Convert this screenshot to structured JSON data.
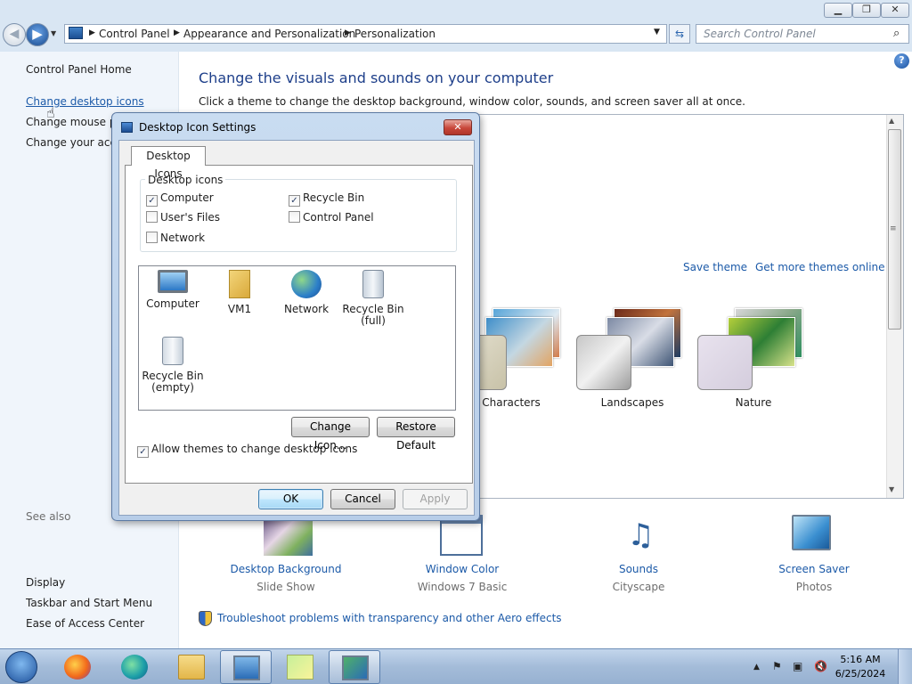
{
  "window": {
    "minimize": "▁",
    "maximize": "❐",
    "close": "✕"
  },
  "address": {
    "crumbs": [
      "Control Panel",
      "Appearance and Personalization",
      "Personalization"
    ],
    "search_placeholder": "Search Control Panel"
  },
  "sidebar": {
    "items": [
      "Control Panel Home",
      "Change desktop icons",
      "Change mouse pointers",
      "Change your account picture"
    ],
    "see_also_title": "See also",
    "see_also": [
      "Display",
      "Taskbar and Start Menu",
      "Ease of Access Center"
    ]
  },
  "main": {
    "title": "Change the visuals and sounds on your computer",
    "subtitle": "Click a theme to change the desktop background, window color, sounds, and screen saver all at once.",
    "save_theme": "Save theme",
    "get_more": "Get more themes online",
    "themes": [
      "Characters",
      "Landscapes",
      "Nature"
    ]
  },
  "options": [
    {
      "label": "Desktop Background",
      "sub": "Slide Show"
    },
    {
      "label": "Window Color",
      "sub": "Windows 7 Basic"
    },
    {
      "label": "Sounds",
      "sub": "Cityscape"
    },
    {
      "label": "Screen Saver",
      "sub": "Photos"
    }
  ],
  "troubleshoot": "Troubleshoot problems with transparency and other Aero effects",
  "dialog": {
    "title": "Desktop Icon Settings",
    "tab": "Desktop Icons",
    "group_label": "Desktop icons",
    "checkboxes": [
      {
        "label": "Computer",
        "checked": true
      },
      {
        "label": "Recycle Bin",
        "checked": true
      },
      {
        "label": "User's Files",
        "checked": false
      },
      {
        "label": "Control Panel",
        "checked": false
      },
      {
        "label": "Network",
        "checked": false
      }
    ],
    "icons": [
      {
        "label": "Computer",
        "icon": "computer-icon"
      },
      {
        "label": "VM1",
        "icon": "user-folder-icon"
      },
      {
        "label": "Network",
        "icon": "network-icon"
      },
      {
        "label": "Recycle Bin (full)",
        "icon": "recycle-bin-full-icon"
      },
      {
        "label": "Recycle Bin (empty)",
        "icon": "recycle-bin-empty-icon"
      }
    ],
    "change_icon": "Change Icon...",
    "restore_default": "Restore Default",
    "allow_themes": "Allow themes to change desktop icons",
    "allow_themes_checked": true,
    "ok": "OK",
    "cancel": "Cancel",
    "apply": "Apply"
  },
  "taskbar": {
    "time": "5:16 AM",
    "date": "6/25/2024",
    "apps": [
      "firefox-icon",
      "edge-icon",
      "explorer-icon",
      "control-panel-icon",
      "sticky-notes-icon",
      "personalization-icon"
    ]
  }
}
